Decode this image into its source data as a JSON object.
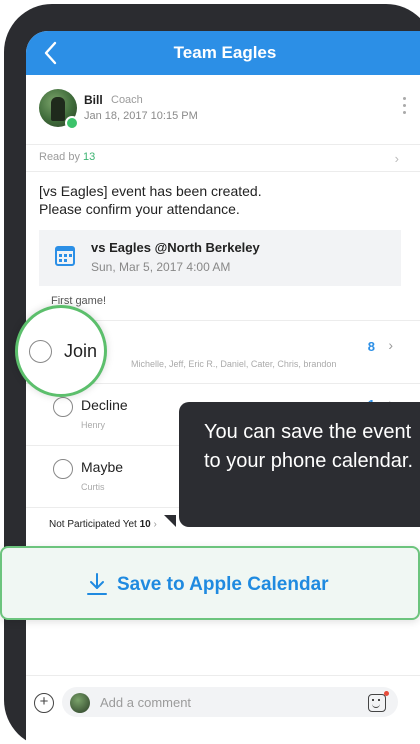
{
  "header": {
    "title": "Team Eagles"
  },
  "post": {
    "author": "Bill",
    "role": "Coach",
    "timestamp": "Jan 18, 2017 10:15 PM",
    "read_prefix": "Read by ",
    "read_count": "13",
    "body_line1": "[vs Eagles] event has been created.",
    "body_line2": "Please confirm your attendance."
  },
  "event": {
    "title": "vs Eagles @North Berkeley",
    "date": "Sun, Mar 5, 2017 4:00 AM",
    "note": "First game!"
  },
  "rsvp": {
    "join": {
      "label": "Join",
      "names": "Michelle, Jeff, Eric R., Daniel, Cater, Chris, brandon",
      "count": "8"
    },
    "decline": {
      "label": "Decline",
      "names": "Henry",
      "count": "1"
    },
    "maybe": {
      "label": "Maybe",
      "names": "Curtis"
    }
  },
  "not_participated": {
    "label": "Not Participated Yet",
    "count": "10"
  },
  "tooltip": {
    "text": "You can save the event to your phone calendar."
  },
  "save_button": {
    "label": "Save to Apple Calendar"
  },
  "comment": {
    "placeholder": "Add a comment"
  },
  "colors": {
    "accent": "#2c8fe6",
    "highlight": "#5cbf6c",
    "tooltip_bg": "#2c2d32"
  },
  "icons": [
    "back-chevron-icon",
    "more-icon",
    "calendar-icon",
    "download-icon",
    "plus-icon",
    "sticker-icon"
  ]
}
